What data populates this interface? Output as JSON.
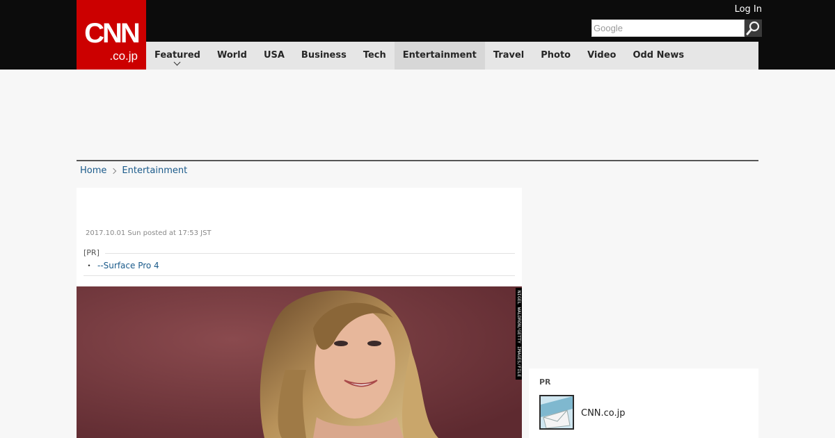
{
  "header": {
    "logo_main": "CNN",
    "logo_sub": ".co.jp",
    "login_label": "Log In",
    "search": {
      "placeholder": "Google",
      "value": ""
    }
  },
  "nav": {
    "items": [
      {
        "label": "Featured",
        "has_dropdown": true
      },
      {
        "label": "World"
      },
      {
        "label": "USA"
      },
      {
        "label": "Business"
      },
      {
        "label": "Tech"
      },
      {
        "label": "Entertainment",
        "active": true
      },
      {
        "label": "Travel"
      },
      {
        "label": "Photo"
      },
      {
        "label": "Video"
      },
      {
        "label": "Odd News"
      }
    ]
  },
  "breadcrumb": {
    "home": "Home",
    "current": "Entertainment"
  },
  "article": {
    "posted": "2017.10.01 Sun posted at 17:53 JST",
    "pr_label": "[PR]",
    "pr_link_bullet": "・",
    "pr_link": "--Surface Pro 4",
    "photo_credit": "NIGEL WALDRON/GETTY IMAGES/FILE"
  },
  "sidebar_pr": {
    "title": "PR",
    "item_text": "CNN.co.jp"
  },
  "colors": {
    "brand_red": "#cc0000",
    "topbar": "#0c0c0c",
    "nav_bg": "#e6e6e6",
    "link": "#1a5a8a"
  }
}
